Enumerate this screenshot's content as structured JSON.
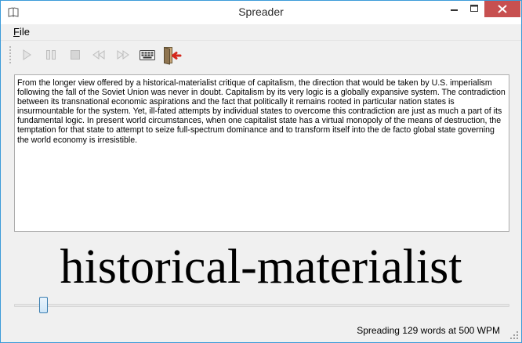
{
  "window": {
    "title": "Spreader",
    "icon": "book-icon",
    "controls": [
      "minimize-icon",
      "maximize-icon",
      "close-icon"
    ]
  },
  "menubar": {
    "items": [
      {
        "label": "File",
        "accel_char": "F",
        "rest": "ile"
      }
    ]
  },
  "toolbar": {
    "buttons": [
      {
        "icon": "play-icon",
        "enabled": false
      },
      {
        "icon": "pause-icon",
        "enabled": false
      },
      {
        "icon": "stop-icon",
        "enabled": false
      },
      {
        "icon": "rewind-icon",
        "enabled": false
      },
      {
        "icon": "fast-forward-icon",
        "enabled": false
      },
      {
        "icon": "keyboard-icon",
        "enabled": true
      },
      {
        "icon": "exit-icon",
        "enabled": true
      }
    ]
  },
  "text_pane": {
    "content": "From the longer view offered by a historical-materialist critique of capitalism, the direction that would be taken by U.S. imperialism following the fall of the Soviet Union was never in doubt. Capitalism by its very logic is a globally expansive system. The contradiction between its transnational economic aspirations and the fact that politically it remains rooted in particular nation states is insurmountable for the system. Yet, ill-fated attempts by individual states to overcome this contradiction are just as much a part of its fundamental logic. In present world circumstances, when one capitalist state has a virtual monopoly of the means of destruction, the temptation for that state to attempt to seize full-spectrum dominance and to transform itself into the de facto global state governing the world economy is irresistible."
  },
  "current_word": "historical-materialist",
  "progress_slider": {
    "fraction": 0.06
  },
  "status": {
    "text": "Spreading 129 words at 500 WPM"
  },
  "colors": {
    "accent": "#3c9bd9",
    "close_button": "#c75050",
    "disabled_icon": "#c4c4c4"
  }
}
